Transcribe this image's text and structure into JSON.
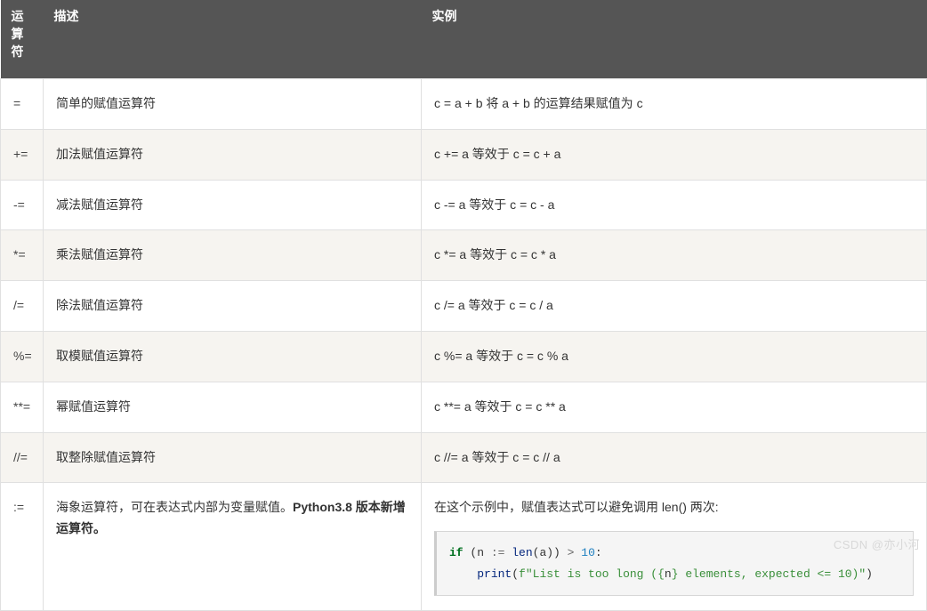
{
  "headers": {
    "col1": "运算符",
    "col2": "描述",
    "col3": "实例"
  },
  "rows": [
    {
      "op": "=",
      "desc": "简单的赋值运算符",
      "ex": "c = a + b 将 a + b 的运算结果赋值为 c"
    },
    {
      "op": "+=",
      "desc": "加法赋值运算符",
      "ex": "c += a 等效于 c = c + a"
    },
    {
      "op": "-=",
      "desc": "减法赋值运算符",
      "ex": "c -= a 等效于 c = c - a"
    },
    {
      "op": "*=",
      "desc": "乘法赋值运算符",
      "ex": "c *= a 等效于 c = c * a"
    },
    {
      "op": "/=",
      "desc": "除法赋值运算符",
      "ex": "c /= a 等效于 c = c / a"
    },
    {
      "op": "%=",
      "desc": "取模赋值运算符",
      "ex": "c %= a 等效于 c = c % a"
    },
    {
      "op": "**=",
      "desc": "幂赋值运算符",
      "ex": "c **= a 等效于 c = c ** a"
    },
    {
      "op": "//=",
      "desc": "取整除赋值运算符",
      "ex": "c //= a 等效于 c = c // a"
    }
  ],
  "walrus": {
    "op": ":=",
    "desc_prefix": "海象运算符，可在表达式内部为变量赋值。",
    "desc_bold": "Python3.8 版本新增运算符。",
    "ex_intro": "在这个示例中，赋值表达式可以避免调用 len() 两次:",
    "code": {
      "if": "if",
      "open": " (n ",
      "assign": ":=",
      "len": " len",
      "call_open": "(a)) ",
      "gt": ">",
      "sp": " ",
      "ten": "10",
      "colon": ":",
      "indent": "    ",
      "print": "print",
      "po": "(",
      "f": "f\"List is too long (",
      "lb": "{",
      "n": "n",
      "rb": "}",
      "tail": " elements, expected <= 10)\"",
      "pc": ")"
    }
  },
  "watermark": "CSDN @亦小河"
}
